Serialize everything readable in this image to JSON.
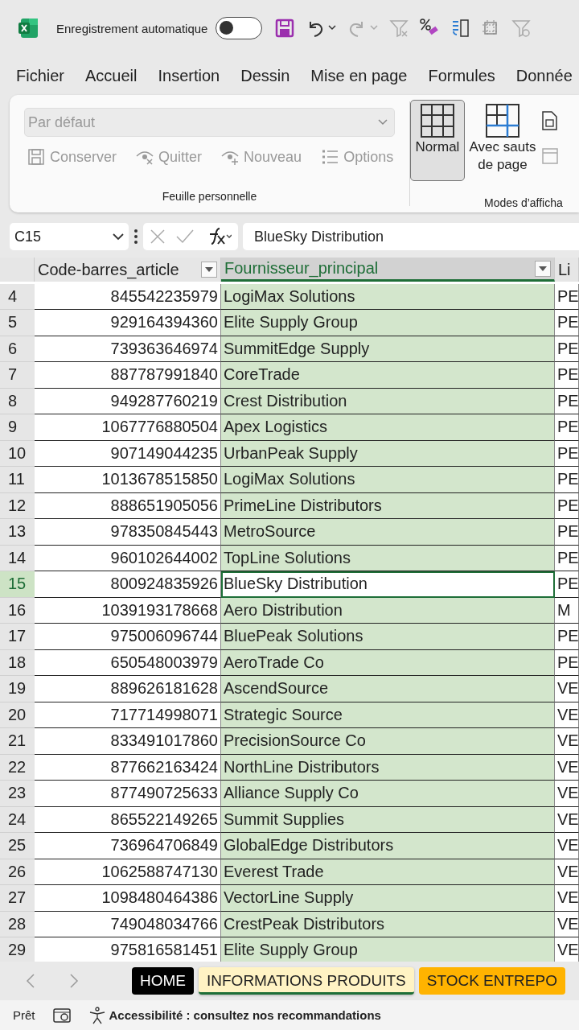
{
  "title_bar": {
    "autosave_label": "Enregistrement automatique",
    "autosave_on": false
  },
  "menu_tabs": [
    "Fichier",
    "Accueil",
    "Insertion",
    "Dessin",
    "Mise en page",
    "Formules",
    "Donnée"
  ],
  "ribbon": {
    "view_dropdown": {
      "value": "Par défaut",
      "disabled": true
    },
    "sheet_view_buttons": [
      {
        "label": "Conserver",
        "kind": "save",
        "disabled": true
      },
      {
        "label": "Quitter",
        "kind": "exit",
        "disabled": true
      },
      {
        "label": "Nouveau",
        "kind": "new",
        "disabled": true
      },
      {
        "label": "Options",
        "kind": "options",
        "disabled": true
      }
    ],
    "group_1_label": "Feuille personnelle",
    "view_modes": [
      {
        "label": "Normal",
        "kind": "normal",
        "selected": true
      },
      {
        "label": "Avec sauts de page",
        "kind": "breaks",
        "selected": false
      }
    ],
    "group_2_label": "Modes d’afficha"
  },
  "formula_bar": {
    "name_box": "C15",
    "formula": "BlueSky Distribution"
  },
  "grid": {
    "columns": [
      {
        "label": "Code-barres_article",
        "filter": true,
        "selected": false,
        "kind": "number"
      },
      {
        "label": "Fournisseur_principal",
        "filter": true,
        "selected": true,
        "kind": "text"
      },
      {
        "label": "Li",
        "filter": false,
        "selected": false,
        "kind": "text"
      }
    ],
    "rows": [
      {
        "number": "4",
        "cells": [
          "845542235979",
          "LogiMax Solutions",
          "PE"
        ],
        "selected": false
      },
      {
        "number": "5",
        "cells": [
          "929164394360",
          "Elite Supply Group",
          "PE"
        ],
        "selected": false
      },
      {
        "number": "6",
        "cells": [
          "739363646974",
          "SummitEdge Supply",
          "PE"
        ],
        "selected": false
      },
      {
        "number": "7",
        "cells": [
          "887787991840",
          "CoreTrade",
          "PE"
        ],
        "selected": false
      },
      {
        "number": "8",
        "cells": [
          "949287760219",
          "Crest Distribution",
          "PE"
        ],
        "selected": false
      },
      {
        "number": "9",
        "cells": [
          "1067776880504",
          "Apex Logistics",
          "PE"
        ],
        "selected": false
      },
      {
        "number": "10",
        "cells": [
          "907149044235",
          "UrbanPeak Supply",
          "PE"
        ],
        "selected": false
      },
      {
        "number": "11",
        "cells": [
          "1013678515850",
          "LogiMax Solutions",
          "PE"
        ],
        "selected": false
      },
      {
        "number": "12",
        "cells": [
          "888651905056",
          "PrimeLine Distributors",
          "PE"
        ],
        "selected": false
      },
      {
        "number": "13",
        "cells": [
          "978350845443",
          "MetroSource",
          "PE"
        ],
        "selected": false
      },
      {
        "number": "14",
        "cells": [
          "960102644002",
          "TopLine Solutions",
          "PE"
        ],
        "selected": false
      },
      {
        "number": "15",
        "cells": [
          "800924835926",
          "BlueSky Distribution",
          "PE"
        ],
        "selected": true
      },
      {
        "number": "16",
        "cells": [
          "1039193178668",
          "Aero Distribution",
          "M"
        ],
        "selected": false
      },
      {
        "number": "17",
        "cells": [
          "975006096744",
          "BluePeak Solutions",
          "PE"
        ],
        "selected": false
      },
      {
        "number": "18",
        "cells": [
          "650548003979",
          "AeroTrade Co",
          "PE"
        ],
        "selected": false
      },
      {
        "number": "19",
        "cells": [
          "889626181628",
          "AscendSource",
          "VE"
        ],
        "selected": false
      },
      {
        "number": "20",
        "cells": [
          "717714998071",
          "Strategic Source",
          "VE"
        ],
        "selected": false
      },
      {
        "number": "21",
        "cells": [
          "833491017860",
          "PrecisionSource Co",
          "VE"
        ],
        "selected": false
      },
      {
        "number": "22",
        "cells": [
          "877662163424",
          "NorthLine Distributors",
          "VE"
        ],
        "selected": false
      },
      {
        "number": "23",
        "cells": [
          "877490725633",
          "Alliance Supply Co",
          "VE"
        ],
        "selected": false
      },
      {
        "number": "24",
        "cells": [
          "865522149265",
          "Summit Supplies",
          "VE"
        ],
        "selected": false
      },
      {
        "number": "25",
        "cells": [
          "736964706849",
          "GlobalEdge Distributors",
          "VE"
        ],
        "selected": false
      },
      {
        "number": "26",
        "cells": [
          "1062588747130",
          "Everest Trade",
          "VE"
        ],
        "selected": false
      },
      {
        "number": "27",
        "cells": [
          "1098480464386",
          "VectorLine Supply",
          "VE"
        ],
        "selected": false
      },
      {
        "number": "28",
        "cells": [
          "749048034766",
          "CrestPeak Distributors",
          "VE"
        ],
        "selected": false
      },
      {
        "number": "29",
        "cells": [
          "975816581451",
          "Elite Supply Group",
          "VE"
        ],
        "selected": false
      }
    ]
  },
  "sheet_tabs": [
    {
      "label": "HOME",
      "color": "#000000",
      "selected": false
    },
    {
      "label": "INFORMATIONS PRODUITS",
      "color": "#fff3c4",
      "selected": true
    },
    {
      "label": "STOCK ENTREPO",
      "color": "#ffb300",
      "selected": false
    }
  ],
  "status_bar": {
    "status": "Prêt",
    "accessibility": "Accessibilité : consultez nos recommandations"
  }
}
